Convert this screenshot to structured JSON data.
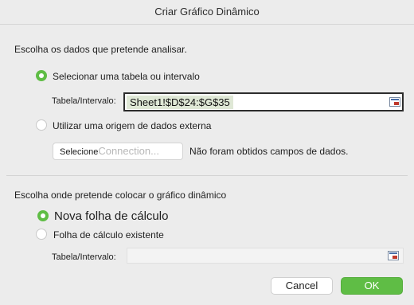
{
  "window": {
    "title": "Criar Gráfico Dinâmico"
  },
  "source_section": {
    "heading": "Escolha os dados que pretende analisar.",
    "option_table": {
      "label": "Selecionar uma tabela ou intervalo",
      "selected": true
    },
    "table_range": {
      "label": "Tabela/Intervalo:",
      "value": "Sheet1!$D$24:$G$35",
      "icon": "range-picker-icon"
    },
    "option_external": {
      "label": "Utilizar uma origem de dados externa",
      "selected": false
    },
    "select_button": {
      "label": "Selecione",
      "ghost_label": "Connection..."
    },
    "status": "Não foram obtidos campos de dados."
  },
  "destination_section": {
    "heading": "Escolha onde pretende colocar o gráfico dinâmico",
    "option_new_sheet": {
      "label": "Nova folha de cálculo",
      "selected": true
    },
    "option_existing_sheet": {
      "label": "Folha de cálculo existente",
      "selected": false
    },
    "table_range": {
      "label": "Tabela/Intervalo:",
      "value": "",
      "icon": "range-picker-icon"
    }
  },
  "buttons": {
    "cancel": "Cancel",
    "ok": "OK"
  },
  "colors": {
    "accent": "#5fbd45",
    "background": "#ececec",
    "range_highlight": "#dfe8d6"
  }
}
